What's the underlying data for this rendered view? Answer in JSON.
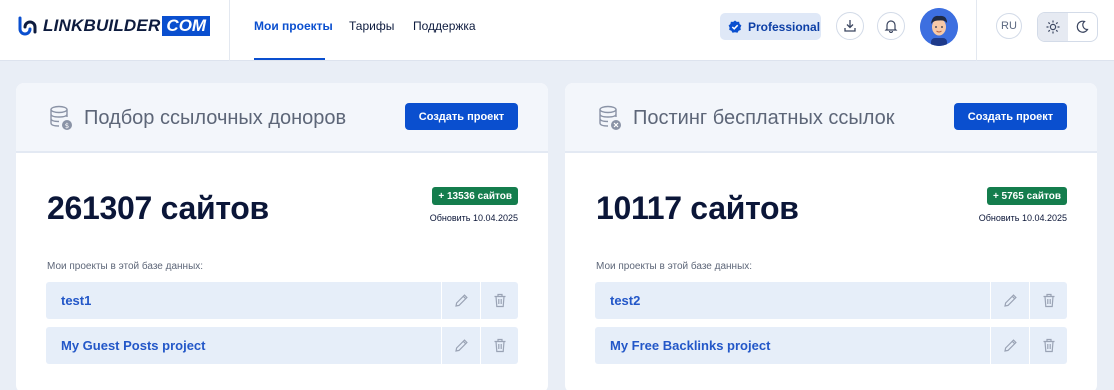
{
  "logo": {
    "text": "LINKBUILDER",
    "com": "COM"
  },
  "nav": {
    "projects": "Мои проекты",
    "tariffs": "Тарифы",
    "support": "Поддержка"
  },
  "plan": {
    "label": "Professional"
  },
  "lang": "RU",
  "icons": {
    "logo": "link-logo-icon",
    "plan": "verified-check-icon",
    "download": "download-icon",
    "notifications": "bell-icon",
    "avatar": "user-avatar",
    "light": "sun-icon",
    "dark": "moon-icon",
    "database": "database-icon",
    "edit": "pencil-icon",
    "delete": "trash-icon"
  },
  "colors": {
    "primary": "#0a4fcf",
    "success": "#147d4d",
    "background": "#e9eef6"
  },
  "cards": [
    {
      "title": "Подбор ссылочных доноров",
      "create_label": "Создать проект",
      "count": "261307 сайтов",
      "delta": "+ 13536 сайтов",
      "updated": "Обновить 10.04.2025",
      "projects_label": "Мои проекты в этой базе данных:",
      "projects": [
        {
          "name": "test1"
        },
        {
          "name": "My Guest Posts project"
        }
      ]
    },
    {
      "title": "Постинг бесплатных ссылок",
      "create_label": "Создать проект",
      "count": "10117 сайтов",
      "delta": "+ 5765 сайтов",
      "updated": "Обновить 10.04.2025",
      "projects_label": "Мои проекты в этой базе данных:",
      "projects": [
        {
          "name": "test2"
        },
        {
          "name": "My Free Backlinks project"
        }
      ]
    }
  ]
}
